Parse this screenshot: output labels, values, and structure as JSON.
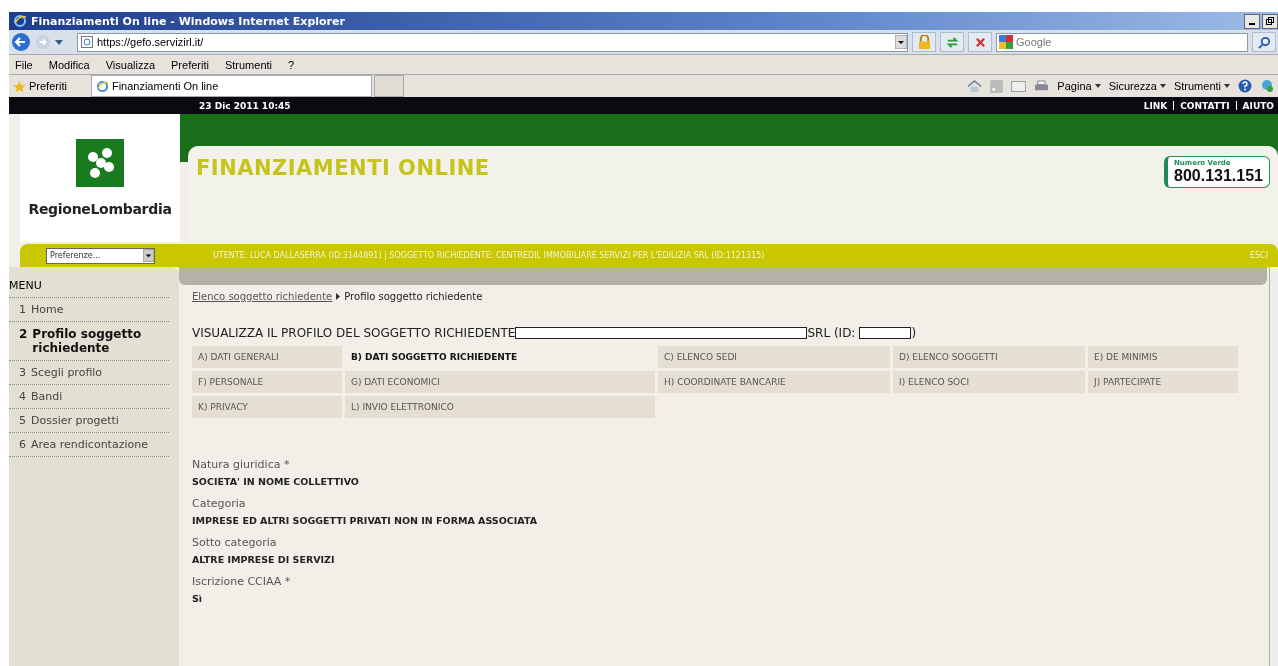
{
  "browser": {
    "title": "Finanziamenti On line - Windows Internet Explorer",
    "url": "https://gefo.servizirl.it/",
    "search_placeholder": "Google",
    "menu": [
      "File",
      "Modifica",
      "Visualizza",
      "Preferiti",
      "Strumenti",
      "?"
    ],
    "favorites": "Preferiti",
    "tab": "Finanziamenti On line",
    "commands": [
      "Pagina",
      "Sicurezza",
      "Strumenti"
    ]
  },
  "top_bar": {
    "date": "23 Dic 2011 10:45",
    "links": [
      "LINK",
      "CONTATTI",
      "AIUTO"
    ]
  },
  "header": {
    "logo": "RegioneLombardia",
    "title": "FINANZIAMENTI ONLINE",
    "hotline_label": "Numero Verde",
    "hotline_number": "800.131.151"
  },
  "user_bar": {
    "preferences": "Preferenze...",
    "text": "UTENTE:  LUCA DALLASERRA (ID:3144891)  |  SOGGETTO RICHIEDENTE:  CENTREDIL IMMOBILIARE SERVIZI PER L'EDILIZIA SRL (ID:1121315)",
    "logout": "ESCI"
  },
  "sidebar": {
    "title": "MENU",
    "items": [
      {
        "number": "1",
        "label": "Home",
        "selected": false
      },
      {
        "number": "2",
        "label": "Profilo soggetto richiedente",
        "selected": true
      },
      {
        "number": "3",
        "label": "Scegli profilo",
        "selected": false
      },
      {
        "number": "4",
        "label": "Bandi",
        "selected": false
      },
      {
        "number": "5",
        "label": "Dossier progetti",
        "selected": false
      },
      {
        "number": "6",
        "label": "Area rendicontazione",
        "selected": false
      }
    ]
  },
  "breadcrumb": {
    "link": "Elenco soggetto richiedente",
    "current": "Profilo soggetto richiedente"
  },
  "heading": {
    "text": "VISUALIZZA IL PROFILO DEL SOGGETTO RICHIEDENTE",
    "suffix": "SRL (ID:",
    "close": ")"
  },
  "tabs": [
    {
      "label": "A) DATI GENERALI",
      "selected": false
    },
    {
      "label": "B) DATI SOGGETTO RICHIEDENTE",
      "selected": true
    },
    {
      "label": "C) ELENCO SEDI",
      "selected": false
    },
    {
      "label": "D) ELENCO SOGGETTI",
      "selected": false
    },
    {
      "label": "E) DE MINIMIS",
      "selected": false
    },
    {
      "label": "F) PERSONALE",
      "selected": false
    },
    {
      "label": "G) DATI ECONOMICI",
      "selected": false
    },
    {
      "label": "H) COORDINATE BANCARIE",
      "selected": false
    },
    {
      "label": "I) ELENCO SOCI",
      "selected": false
    },
    {
      "label": "J) PARTECIPATE",
      "selected": false
    },
    {
      "label": "K) PRIVACY",
      "selected": false
    },
    {
      "label": "L) INVIO ELETTRONICO",
      "selected": false
    }
  ],
  "fields": [
    {
      "label": "Natura giuridica *",
      "value": "SOCIETA' IN NOME COLLETTIVO"
    },
    {
      "label": "Categoria",
      "value": "IMPRESE ED ALTRI SOGGETTI PRIVATI NON IN FORMA ASSOCIATA"
    },
    {
      "label": "Sotto categoria",
      "value": "ALTRE IMPRESE DI SERVIZI"
    },
    {
      "label": "Iscrizione CCIAA *",
      "value": "Sì"
    }
  ]
}
